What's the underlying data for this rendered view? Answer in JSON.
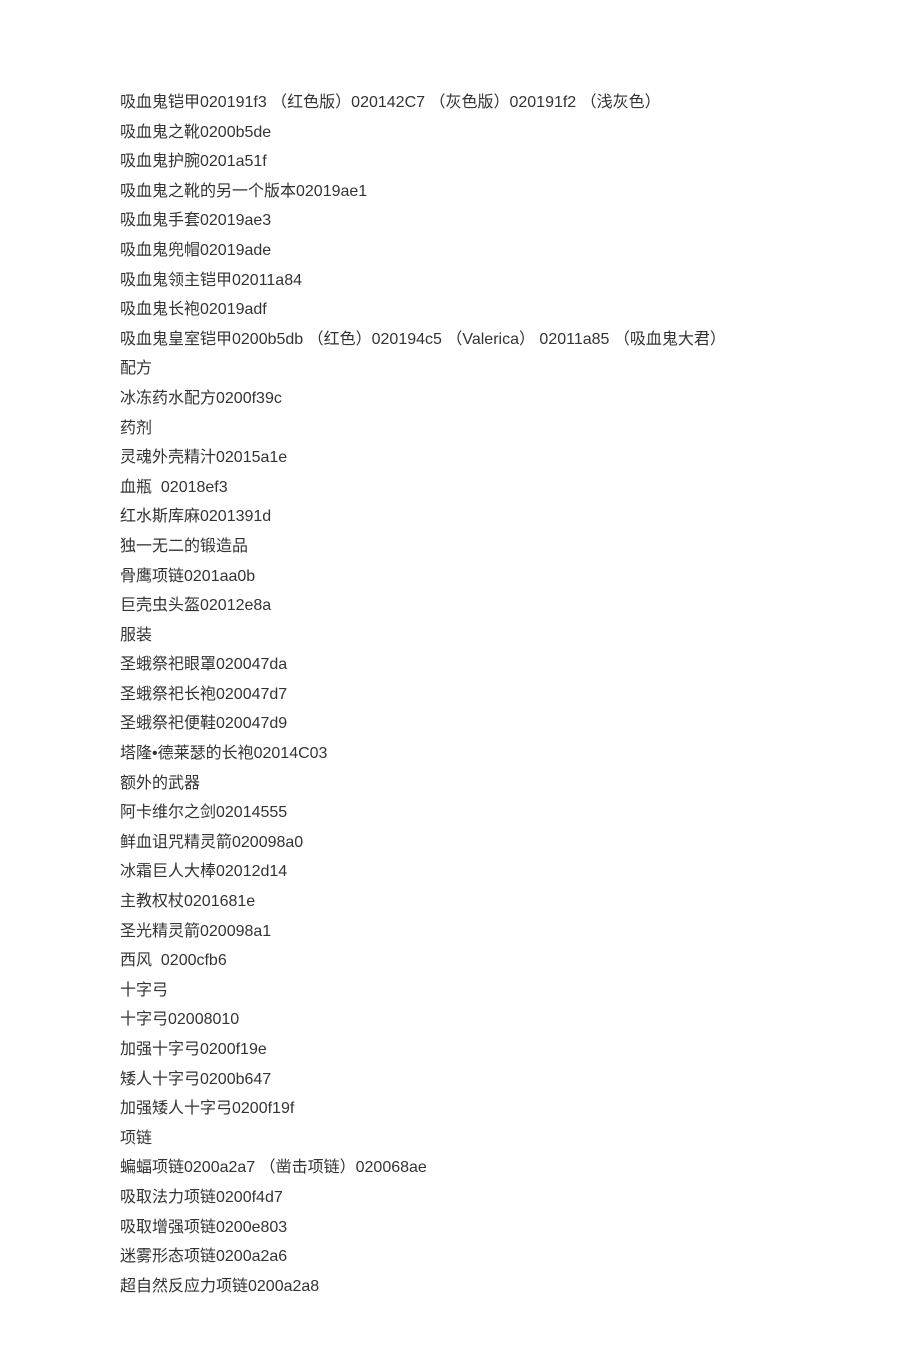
{
  "lines": [
    "吸血鬼铠甲020191f3 （红色版）020142C7 （灰色版）020191f2 （浅灰色）",
    "吸血鬼之靴0200b5de",
    "吸血鬼护腕0201a51f",
    "吸血鬼之靴的另一个版本02019ae1",
    "吸血鬼手套02019ae3",
    "吸血鬼兜帽02019ade",
    "吸血鬼领主铠甲02011a84",
    "吸血鬼长袍02019adf",
    "吸血鬼皇室铠甲0200b5db （红色）020194c5 （Valerica） 02011a85 （吸血鬼大君）",
    "配方",
    "冰冻药水配方0200f39c",
    "药剂",
    "灵魂外壳精汁02015a1e",
    "血瓶  02018ef3",
    "红水斯库麻0201391d",
    "独一无二的锻造品",
    "骨鹰项链0201aa0b",
    "巨壳虫头盔02012e8a",
    "服装",
    "圣蛾祭祀眼罩020047da",
    "圣蛾祭祀长袍020047d7",
    "圣蛾祭祀便鞋020047d9",
    "塔隆•德莱瑟的长袍02014C03",
    "额外的武器",
    "阿卡维尔之剑02014555",
    "鲜血诅咒精灵箭020098a0",
    "冰霜巨人大棒02012d14",
    "主教权杖0201681e",
    "圣光精灵箭020098a1",
    "西风  0200cfb6",
    "十字弓",
    "十字弓02008010",
    "加强十字弓0200f19e",
    "矮人十字弓0200b647",
    "加强矮人十字弓0200f19f",
    "项链",
    "蝙蝠项链0200a2a7 （凿击项链）020068ae",
    "吸取法力项链0200f4d7",
    "吸取增强项链0200e803",
    "迷雾形态项链0200a2a6",
    "超自然反应力项链0200a2a8"
  ]
}
